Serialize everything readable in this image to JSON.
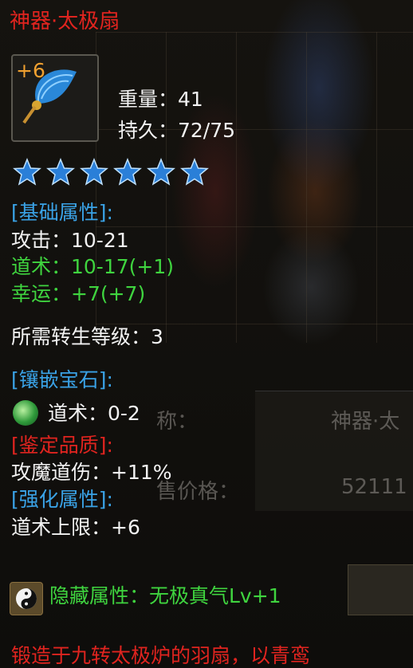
{
  "item": {
    "title": "神器·太极扇",
    "enhance_level": "+6",
    "weight": "重量：41",
    "durability": "持久：72/75",
    "star_count": 6,
    "star_color": "#2a7fd8"
  },
  "base_section": {
    "header": "[基础属性]:",
    "attack": "攻击：10-21",
    "taoism": "道术：10-17(+1)",
    "luck": "幸运：+7(+7)"
  },
  "requirement": "所需转生等级：3",
  "inlay_section": {
    "header": "[镶嵌宝石]:",
    "gem_line": "道术：0-2"
  },
  "identify_section": {
    "header": "[鉴定品质]:",
    "line": "攻魔道伤：+11%"
  },
  "enhance_section": {
    "header": "[强化属性]:",
    "line": "道术上限：+6"
  },
  "hidden": "隐藏属性：无极真气Lv+1",
  "description": "锻造于九转太极炉的羽扇，以青鸾",
  "background_panel": {
    "name_label": "称：",
    "name_value": "神器·太",
    "price_label": "售价格：",
    "price_value": "52111"
  },
  "colors": {
    "red": "#e0241f",
    "green": "#3fd43f",
    "blue": "#3aa2e6",
    "white": "#f2f2f2",
    "orange": "#f0a030"
  }
}
